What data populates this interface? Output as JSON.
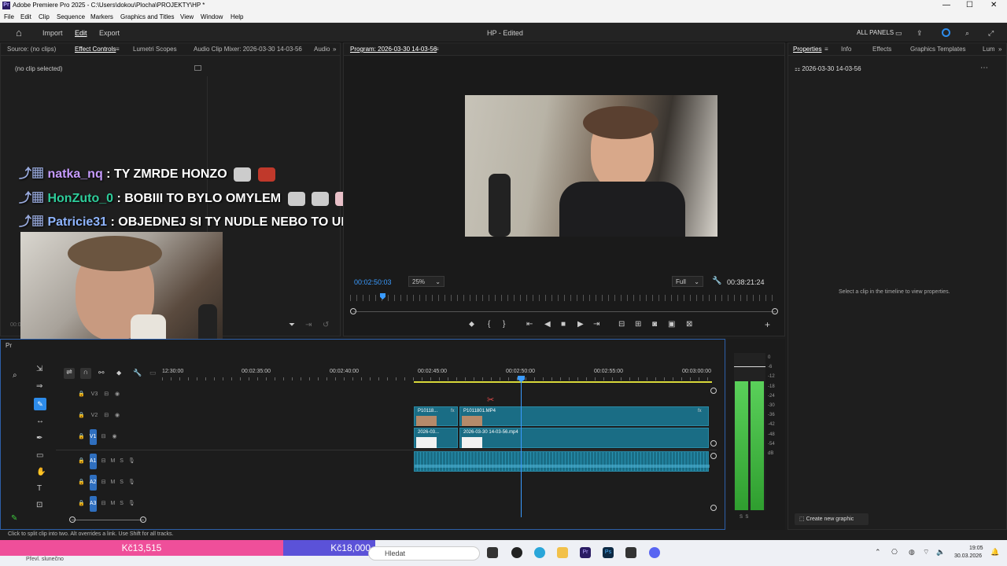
{
  "titlebar": {
    "title": "Adobe Premiere Pro 2025 - C:\\Users\\dokou\\Plocha\\PROJEKTY\\HP *",
    "app_icon": "Pr",
    "minimize": "—",
    "maximize": "☐",
    "close": "✕"
  },
  "menu": [
    "File",
    "Edit",
    "Clip",
    "Sequence",
    "Markers",
    "Graphics and Titles",
    "View",
    "Window",
    "Help"
  ],
  "header": {
    "import": "Import",
    "edit": "Edit",
    "export": "Export",
    "project": "HP - Edited",
    "all_panels": "ALL PANELS"
  },
  "source_panel": {
    "tabs": [
      "Source: (no clips)",
      "Effect Controls",
      "Lumetri Scopes",
      "Audio Clip Mixer: 2026-03-30 14-03-56",
      "Audio"
    ],
    "no_clip": "(no clip selected)",
    "timecode": "00:0"
  },
  "chat": [
    {
      "user": "natka_nq",
      "color": "#c69bff",
      "message": ": TY ZMRDE HONZO"
    },
    {
      "user": "HonZuto_0",
      "color": "#2ecc9a",
      "message": ": BOBIII TO BYLO OMYLEM"
    },
    {
      "user": "Patricie31",
      "color": "#8fb5ff",
      "message": ": OBJEDNEJ SI TY NUDLE NEBO TO UDELAM JA"
    }
  ],
  "program": {
    "tab": "Program: 2026-03-30 14-03-56",
    "timecode": "00:02:50:03",
    "zoom": "25%",
    "quality": "Full",
    "duration": "00:38:21:24"
  },
  "properties": {
    "tabs": [
      "Properties",
      "Info",
      "Effects",
      "Graphics Templates",
      "Lum"
    ],
    "sequence": "2026-03-30 14-03-56",
    "hint": "Select a clip in the timeline to view properties.",
    "create_graphic": "Create new graphic"
  },
  "timeline": {
    "project_tab": "Pr",
    "ruler": [
      "12:30:00",
      "00:02:35:00",
      "00:02:40:00",
      "00:02:45:00",
      "00:02:50:00",
      "00:02:55:00",
      "00:03:00:00"
    ],
    "tracks": [
      "V3",
      "V2",
      "V1",
      "A1",
      "A2",
      "A3"
    ],
    "clips": {
      "v2_a": "P10118...",
      "v2_b": "P1011801.MP4",
      "v1_a": "2026-03...",
      "v1_b": "2026-03-30 14-03-56.mp4"
    },
    "meter_scale": [
      "0",
      "-6",
      "-12",
      "-18",
      "-24",
      "-30",
      "-36",
      "-42",
      "-48",
      "-54",
      "dB"
    ],
    "meter_ss": "S  S"
  },
  "status_text": "Click to split clip into two. Alt overrides a link. Use Shift for all tracks.",
  "overlay": {
    "left_amount": "Kč13,515",
    "right_amount": "Kč18,000"
  },
  "taskbar": {
    "search": "Hledat",
    "weather": "Převl. slunečno",
    "time": "19:05",
    "date": "30.03.2026"
  },
  "colors": {
    "accent": "#2d8ceb",
    "playhead": "#3a9bff",
    "clip": "#1a6d85",
    "meter": "#3ec43e",
    "pink_bar": "#ef4f9a",
    "purple_bar": "#5b52d8"
  }
}
